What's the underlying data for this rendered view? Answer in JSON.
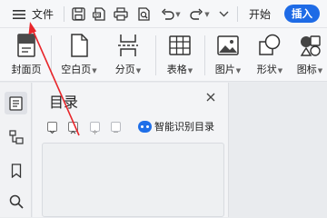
{
  "topbar": {
    "menu_icon": "hamburger-icon",
    "file_label": "文件",
    "quick_tools": [
      "save-icon",
      "export-pdf-icon",
      "print-icon",
      "print-preview-icon",
      "undo-icon",
      "redo-icon",
      "more-icon"
    ],
    "tabs": [
      {
        "label": "开始",
        "active": false
      },
      {
        "label": "插入",
        "active": true
      }
    ]
  },
  "ribbon": {
    "items": [
      {
        "label": "封面页",
        "icon": "cover-page-icon",
        "has_dropdown": false
      },
      {
        "label": "空白页",
        "icon": "blank-page-icon",
        "has_dropdown": true
      },
      {
        "label": "分页",
        "icon": "page-break-icon",
        "has_dropdown": true
      },
      {
        "label": "表格",
        "icon": "table-icon",
        "has_dropdown": true
      },
      {
        "label": "图片",
        "icon": "picture-icon",
        "has_dropdown": true
      },
      {
        "label": "形状",
        "icon": "shape-icon",
        "has_dropdown": true
      },
      {
        "label": "图标",
        "icon": "icon-library-icon",
        "has_dropdown": true
      }
    ]
  },
  "rail": {
    "buttons": [
      {
        "name": "toc-icon",
        "active": true
      },
      {
        "name": "navigation-icon",
        "active": false
      },
      {
        "name": "bookmark-icon",
        "active": false
      },
      {
        "name": "search-icon",
        "active": false
      }
    ]
  },
  "toc_panel": {
    "title": "目录",
    "smart_toc_label": "智能识别目录"
  },
  "colors": {
    "accent": "#1e6be6",
    "annotation_arrow": "#e8262b"
  }
}
